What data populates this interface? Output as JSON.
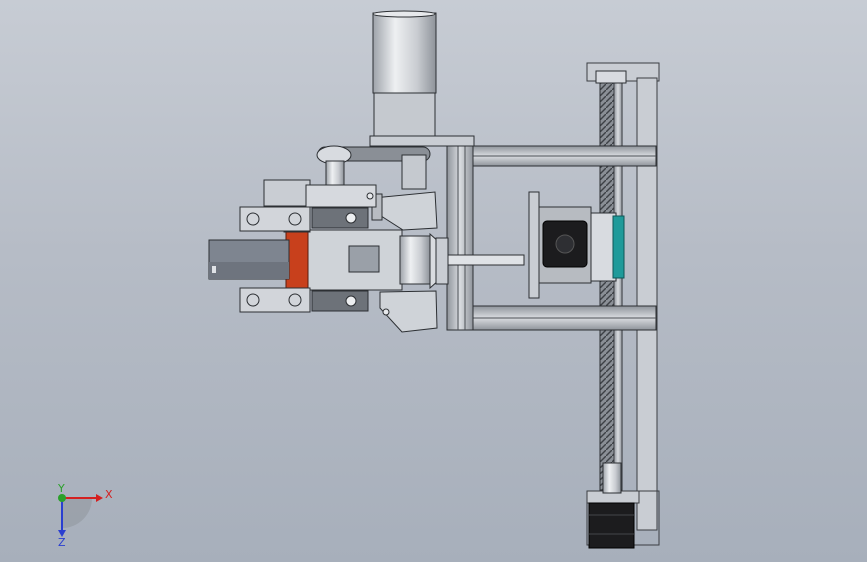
{
  "viewport": {
    "background": "#b9bfc9"
  },
  "triad": {
    "x_label": "X",
    "y_label": "Y",
    "z_label": "Z",
    "x_color": "#d42020",
    "y_color": "#2aa02a",
    "z_color": "#2a3fd0"
  },
  "colors": {
    "metal": "#c9cdd3",
    "metal_dark": "#7c828b",
    "motor_black": "#1c1c1e",
    "accent_red": "#c8401c",
    "accent_teal": "#1f9a9a"
  }
}
